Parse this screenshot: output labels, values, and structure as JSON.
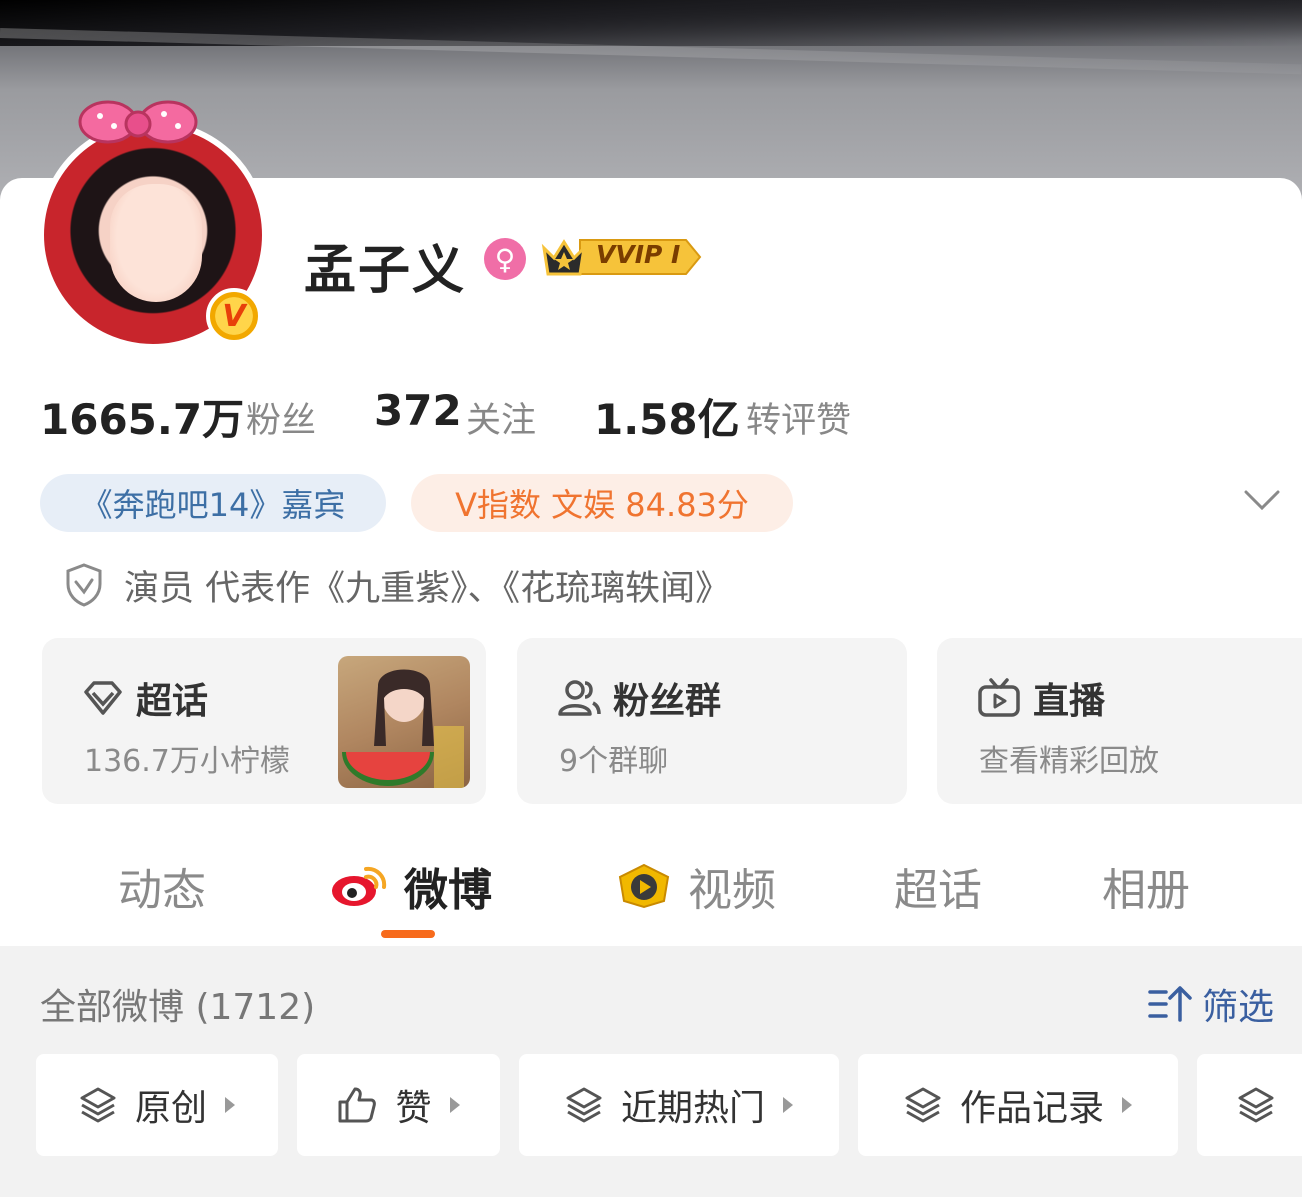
{
  "profile": {
    "name": "孟子义",
    "vip_label": "VVIP I",
    "verified_badge": "V"
  },
  "stats": {
    "followers_num": "1665.7万",
    "followers_label": "粉丝",
    "following_num": "372",
    "following_label": "关注",
    "interactions_num": "1.58亿",
    "interactions_label": "转评赞"
  },
  "tags": {
    "guest": "《奔跑吧14》嘉宾",
    "v_index": "V指数 文娱 84.83分"
  },
  "verification": {
    "text": "演员 代表作《九重紫》、《花琉璃轶闻》"
  },
  "features": [
    {
      "title": "超话",
      "subtitle": "136.7万小柠檬",
      "icon": "diamond-icon"
    },
    {
      "title": "粉丝群",
      "subtitle": "9个群聊",
      "icon": "people-icon"
    },
    {
      "title": "直播",
      "subtitle": "查看精彩回放",
      "icon": "tv-icon"
    }
  ],
  "tabs": [
    {
      "label": "动态"
    },
    {
      "label": "微博",
      "active": true,
      "icon": "weibo-logo-icon"
    },
    {
      "label": "视频",
      "icon": "video-play-icon"
    },
    {
      "label": "超话"
    },
    {
      "label": "相册"
    }
  ],
  "posts": {
    "count_label": "全部微博 (1712)",
    "filter_label": "筛选"
  },
  "chips": [
    {
      "label": "原创",
      "icon": "layers-icon"
    },
    {
      "label": "赞",
      "icon": "thumbs-up-icon"
    },
    {
      "label": "近期热门",
      "icon": "layers-icon"
    },
    {
      "label": "作品记录",
      "icon": "layers-icon"
    },
    {
      "label": "",
      "icon": "layers-icon"
    }
  ],
  "colors": {
    "accent_orange": "#f76b1c",
    "tag_blue_text": "#3d6fa5",
    "tag_orange_text": "#f07430",
    "filter_blue": "#3a5fa0"
  }
}
